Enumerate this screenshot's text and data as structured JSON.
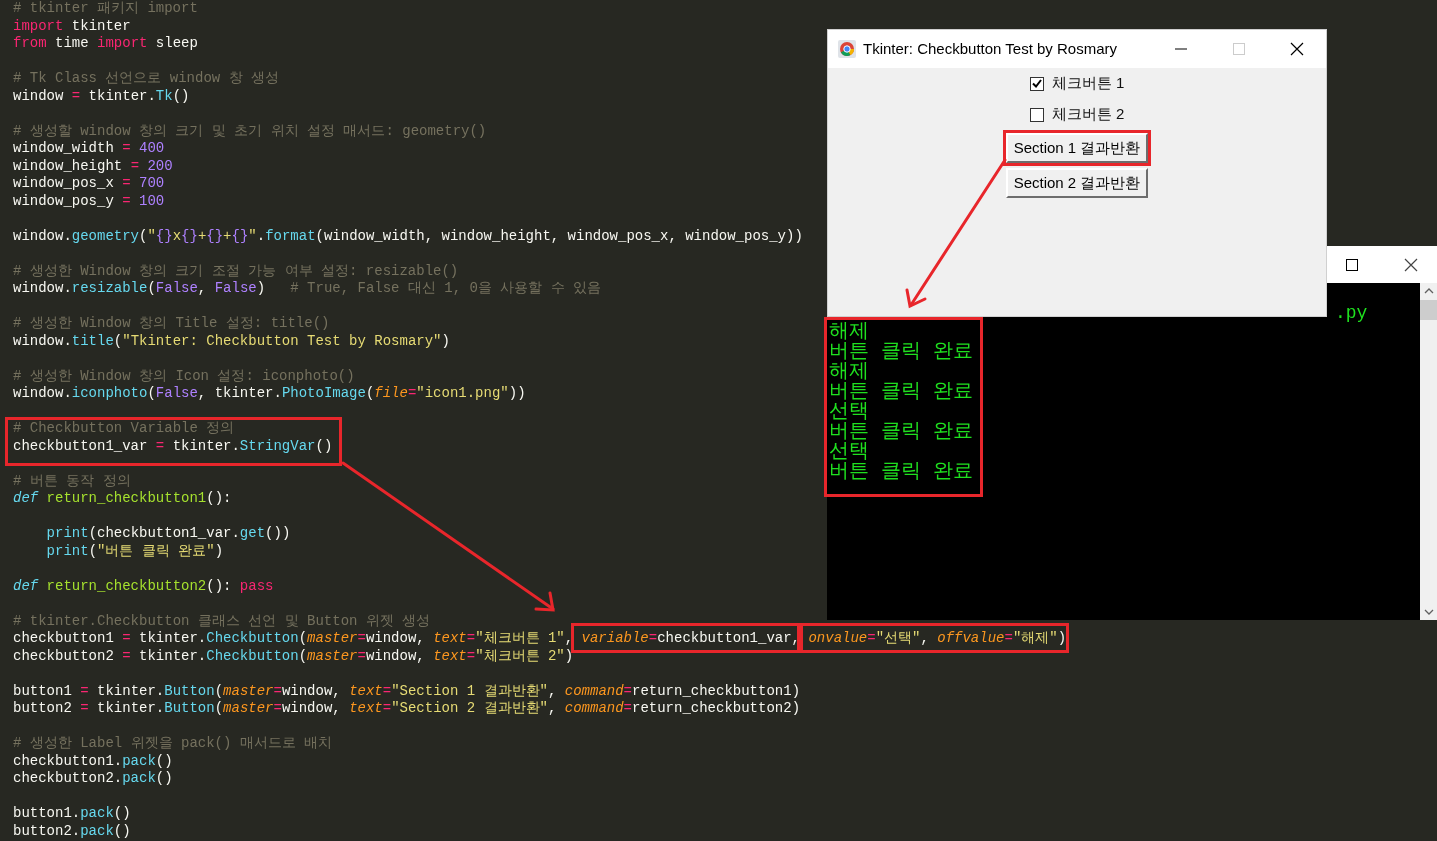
{
  "editor": {
    "lines": [
      {
        "kind": "code",
        "tokens": [
          {
            "text": "# tkinter 패키지 import",
            "kind": "comment"
          }
        ]
      },
      {
        "kind": "code",
        "tokens": [
          {
            "text": "import",
            "kind": "keyword"
          },
          {
            "text": " tkinter",
            "kind": "plain"
          }
        ]
      },
      {
        "kind": "code",
        "tokens": [
          {
            "text": "from",
            "kind": "keyword"
          },
          {
            "text": " time ",
            "kind": "plain"
          },
          {
            "text": "import",
            "kind": "keyword"
          },
          {
            "text": " sleep",
            "kind": "plain"
          }
        ]
      },
      {
        "kind": "blank"
      },
      {
        "kind": "code",
        "tokens": [
          {
            "text": "# Tk Class 선언으로 window 창 생성",
            "kind": "comment"
          }
        ]
      },
      {
        "kind": "code",
        "tokens": [
          {
            "text": "window ",
            "kind": "plain"
          },
          {
            "text": "=",
            "kind": "keyword"
          },
          {
            "text": " tkinter.",
            "kind": "plain"
          },
          {
            "text": "Tk",
            "kind": "call"
          },
          {
            "text": "()",
            "kind": "plain"
          }
        ]
      },
      {
        "kind": "blank"
      },
      {
        "kind": "code",
        "tokens": [
          {
            "text": "# 생성할 window 창의 크기 및 초기 위치 설정 매서드: geometry()",
            "kind": "comment"
          }
        ]
      },
      {
        "kind": "code",
        "tokens": [
          {
            "text": "window_width ",
            "kind": "plain"
          },
          {
            "text": "=",
            "kind": "keyword"
          },
          {
            "text": " 400",
            "kind": "number"
          }
        ]
      },
      {
        "kind": "code",
        "tokens": [
          {
            "text": "window_height ",
            "kind": "plain"
          },
          {
            "text": "=",
            "kind": "keyword"
          },
          {
            "text": " 200",
            "kind": "number"
          }
        ]
      },
      {
        "kind": "code",
        "tokens": [
          {
            "text": "window_pos_x ",
            "kind": "plain"
          },
          {
            "text": "=",
            "kind": "keyword"
          },
          {
            "text": " 700",
            "kind": "number"
          }
        ]
      },
      {
        "kind": "code",
        "tokens": [
          {
            "text": "window_pos_y ",
            "kind": "plain"
          },
          {
            "text": "=",
            "kind": "keyword"
          },
          {
            "text": " 100",
            "kind": "number"
          }
        ]
      },
      {
        "kind": "blank"
      },
      {
        "kind": "code",
        "tokens": [
          {
            "text": "window.",
            "kind": "plain"
          },
          {
            "text": "geometry",
            "kind": "call"
          },
          {
            "text": "(",
            "kind": "plain"
          },
          {
            "text": "\"",
            "kind": "string"
          },
          {
            "text": "{}",
            "kind": "number"
          },
          {
            "text": "x",
            "kind": "string"
          },
          {
            "text": "{}",
            "kind": "number"
          },
          {
            "text": "+",
            "kind": "string"
          },
          {
            "text": "{}",
            "kind": "number"
          },
          {
            "text": "+",
            "kind": "string"
          },
          {
            "text": "{}",
            "kind": "number"
          },
          {
            "text": "\"",
            "kind": "string"
          },
          {
            "text": ".",
            "kind": "plain"
          },
          {
            "text": "format",
            "kind": "call"
          },
          {
            "text": "(window_width, window_height, window_pos_x, window_pos_y))",
            "kind": "plain"
          }
        ]
      },
      {
        "kind": "blank"
      },
      {
        "kind": "code",
        "tokens": [
          {
            "text": "# 생성한 Window 창의 크기 조절 가능 여부 설정: resizable()",
            "kind": "comment"
          }
        ]
      },
      {
        "kind": "code",
        "tokens": [
          {
            "text": "window.",
            "kind": "plain"
          },
          {
            "text": "resizable",
            "kind": "call"
          },
          {
            "text": "(",
            "kind": "plain"
          },
          {
            "text": "False",
            "kind": "number"
          },
          {
            "text": ", ",
            "kind": "plain"
          },
          {
            "text": "False",
            "kind": "number"
          },
          {
            "text": ")   ",
            "kind": "plain"
          },
          {
            "text": "# True, False 대신 1, 0을 사용할 수 있음",
            "kind": "comment"
          }
        ]
      },
      {
        "kind": "blank"
      },
      {
        "kind": "code",
        "tokens": [
          {
            "text": "# 생성한 Window 창의 Title 설정: title()",
            "kind": "comment"
          }
        ]
      },
      {
        "kind": "code",
        "tokens": [
          {
            "text": "window.",
            "kind": "plain"
          },
          {
            "text": "title",
            "kind": "call"
          },
          {
            "text": "(",
            "kind": "plain"
          },
          {
            "text": "\"Tkinter: Checkbutton Test by Rosmary\"",
            "kind": "string"
          },
          {
            "text": ")",
            "kind": "plain"
          }
        ]
      },
      {
        "kind": "blank"
      },
      {
        "kind": "code",
        "tokens": [
          {
            "text": "# 생성한 Window 창의 Icon 설정: iconphoto()",
            "kind": "comment"
          }
        ]
      },
      {
        "kind": "code",
        "tokens": [
          {
            "text": "window.",
            "kind": "plain"
          },
          {
            "text": "iconphoto",
            "kind": "call"
          },
          {
            "text": "(",
            "kind": "plain"
          },
          {
            "text": "False",
            "kind": "number"
          },
          {
            "text": ", tkinter.",
            "kind": "plain"
          },
          {
            "text": "PhotoImage",
            "kind": "call"
          },
          {
            "text": "(",
            "kind": "plain"
          },
          {
            "text": "file",
            "kind": "param"
          },
          {
            "text": "=",
            "kind": "keyword"
          },
          {
            "text": "\"icon1.png\"",
            "kind": "string"
          },
          {
            "text": "))",
            "kind": "plain"
          }
        ]
      },
      {
        "kind": "blank"
      },
      {
        "kind": "highlight",
        "lines": [
          {
            "kind": "code",
            "tokens": [
              {
                "text": "# Checkbutton Variable 정의",
                "kind": "comment"
              }
            ]
          },
          {
            "kind": "code",
            "tokens": [
              {
                "text": "checkbutton1_var ",
                "kind": "plain"
              },
              {
                "text": "=",
                "kind": "keyword"
              },
              {
                "text": " tkinter.",
                "kind": "plain"
              },
              {
                "text": "StringVar",
                "kind": "call"
              },
              {
                "text": "()",
                "kind": "plain"
              }
            ]
          }
        ]
      },
      {
        "kind": "blank"
      },
      {
        "kind": "code",
        "tokens": [
          {
            "text": "# 버튼 동작 정의",
            "kind": "comment"
          }
        ]
      },
      {
        "kind": "code",
        "tokens": [
          {
            "text": "def ",
            "kind": "storage"
          },
          {
            "text": "return_checkbutton1",
            "kind": "function"
          },
          {
            "text": "():",
            "kind": "plain"
          }
        ]
      },
      {
        "kind": "blank"
      },
      {
        "kind": "code",
        "tokens": [
          {
            "text": "    print",
            "kind": "call"
          },
          {
            "text": "(checkbutton1_var.",
            "kind": "plain"
          },
          {
            "text": "get",
            "kind": "call"
          },
          {
            "text": "())",
            "kind": "plain"
          }
        ]
      },
      {
        "kind": "code",
        "tokens": [
          {
            "text": "    print",
            "kind": "call"
          },
          {
            "text": "(",
            "kind": "plain"
          },
          {
            "text": "\"버튼 클릭 완료\"",
            "kind": "string"
          },
          {
            "text": ")",
            "kind": "plain"
          }
        ]
      },
      {
        "kind": "blank"
      },
      {
        "kind": "code",
        "tokens": [
          {
            "text": "def ",
            "kind": "storage"
          },
          {
            "text": "return_checkbutton2",
            "kind": "function"
          },
          {
            "text": "(): ",
            "kind": "plain"
          },
          {
            "text": "pass",
            "kind": "keyword"
          }
        ]
      },
      {
        "kind": "blank"
      },
      {
        "kind": "code",
        "tokens": [
          {
            "text": "# tkinter.Checkbutton 클래스 선언 및 Button 위젯 생성",
            "kind": "comment"
          }
        ]
      },
      {
        "kind": "code",
        "tokens": [
          {
            "text": "checkbutton1 ",
            "kind": "plain"
          },
          {
            "text": "=",
            "kind": "keyword"
          },
          {
            "text": " tkinter.",
            "kind": "plain"
          },
          {
            "text": "Checkbutton",
            "kind": "call"
          },
          {
            "text": "(",
            "kind": "plain"
          },
          {
            "text": "master",
            "kind": "param"
          },
          {
            "text": "=",
            "kind": "keyword"
          },
          {
            "text": "window, ",
            "kind": "plain"
          },
          {
            "text": "text",
            "kind": "param"
          },
          {
            "text": "=",
            "kind": "keyword"
          },
          {
            "text": "\"체크버튼 1\"",
            "kind": "string"
          },
          {
            "text": ", ",
            "kind": "plain"
          },
          {
            "kind": "highlight",
            "tokens": [
              {
                "text": "variable",
                "kind": "param"
              },
              {
                "text": "=",
                "kind": "keyword"
              },
              {
                "text": "checkbutton1_var",
                "kind": "plain"
              }
            ]
          },
          {
            "text": ", ",
            "kind": "plain"
          },
          {
            "kind": "highlight",
            "tokens": [
              {
                "text": "onvalue",
                "kind": "param"
              },
              {
                "text": "=",
                "kind": "keyword"
              },
              {
                "text": "\"선택\"",
                "kind": "string"
              },
              {
                "text": ", ",
                "kind": "plain"
              },
              {
                "text": "offvalue",
                "kind": "param"
              },
              {
                "text": "=",
                "kind": "keyword"
              },
              {
                "text": "\"해제\"",
                "kind": "string"
              }
            ]
          },
          {
            "text": ")",
            "kind": "plain"
          }
        ]
      },
      {
        "kind": "code",
        "tokens": [
          {
            "text": "checkbutton2 ",
            "kind": "plain"
          },
          {
            "text": "=",
            "kind": "keyword"
          },
          {
            "text": " tkinter.",
            "kind": "plain"
          },
          {
            "text": "Checkbutton",
            "kind": "call"
          },
          {
            "text": "(",
            "kind": "plain"
          },
          {
            "text": "master",
            "kind": "param"
          },
          {
            "text": "=",
            "kind": "keyword"
          },
          {
            "text": "window, ",
            "kind": "plain"
          },
          {
            "text": "text",
            "kind": "param"
          },
          {
            "text": "=",
            "kind": "keyword"
          },
          {
            "text": "\"체크버튼 2\"",
            "kind": "string"
          },
          {
            "text": ")",
            "kind": "plain"
          }
        ]
      },
      {
        "kind": "blank"
      },
      {
        "kind": "code",
        "tokens": [
          {
            "text": "button1 ",
            "kind": "plain"
          },
          {
            "text": "=",
            "kind": "keyword"
          },
          {
            "text": " tkinter.",
            "kind": "plain"
          },
          {
            "text": "Button",
            "kind": "call"
          },
          {
            "text": "(",
            "kind": "plain"
          },
          {
            "text": "master",
            "kind": "param"
          },
          {
            "text": "=",
            "kind": "keyword"
          },
          {
            "text": "window, ",
            "kind": "plain"
          },
          {
            "text": "text",
            "kind": "param"
          },
          {
            "text": "=",
            "kind": "keyword"
          },
          {
            "text": "\"Section 1 결과반환\"",
            "kind": "string"
          },
          {
            "text": ", ",
            "kind": "plain"
          },
          {
            "text": "command",
            "kind": "param"
          },
          {
            "text": "=",
            "kind": "keyword"
          },
          {
            "text": "return_checkbutton1)",
            "kind": "plain"
          }
        ]
      },
      {
        "kind": "code",
        "tokens": [
          {
            "text": "button2 ",
            "kind": "plain"
          },
          {
            "text": "=",
            "kind": "keyword"
          },
          {
            "text": " tkinter.",
            "kind": "plain"
          },
          {
            "text": "Button",
            "kind": "call"
          },
          {
            "text": "(",
            "kind": "plain"
          },
          {
            "text": "master",
            "kind": "param"
          },
          {
            "text": "=",
            "kind": "keyword"
          },
          {
            "text": "window, ",
            "kind": "plain"
          },
          {
            "text": "text",
            "kind": "param"
          },
          {
            "text": "=",
            "kind": "keyword"
          },
          {
            "text": "\"Section 2 결과반환\"",
            "kind": "string"
          },
          {
            "text": ", ",
            "kind": "plain"
          },
          {
            "text": "command",
            "kind": "param"
          },
          {
            "text": "=",
            "kind": "keyword"
          },
          {
            "text": "return_checkbutton2)",
            "kind": "plain"
          }
        ]
      },
      {
        "kind": "blank"
      },
      {
        "kind": "code",
        "tokens": [
          {
            "text": "# 생성한 Label 위젯을 pack() 매서드로 배치",
            "kind": "comment"
          }
        ]
      },
      {
        "kind": "code",
        "tokens": [
          {
            "text": "checkbutton1.",
            "kind": "plain"
          },
          {
            "text": "pack",
            "kind": "call"
          },
          {
            "text": "()",
            "kind": "plain"
          }
        ]
      },
      {
        "kind": "code",
        "tokens": [
          {
            "text": "checkbutton2.",
            "kind": "plain"
          },
          {
            "text": "pack",
            "kind": "call"
          },
          {
            "text": "()",
            "kind": "plain"
          }
        ]
      },
      {
        "kind": "blank"
      },
      {
        "kind": "code",
        "tokens": [
          {
            "text": "button1.",
            "kind": "plain"
          },
          {
            "text": "pack",
            "kind": "call"
          },
          {
            "text": "()",
            "kind": "plain"
          }
        ]
      },
      {
        "kind": "code",
        "tokens": [
          {
            "text": "button2.",
            "kind": "plain"
          },
          {
            "text": "pack",
            "kind": "call"
          },
          {
            "text": "()",
            "kind": "plain"
          }
        ]
      }
    ]
  },
  "console": {
    "maximize_disabled": false,
    "script_path": ".py",
    "output": {
      "highlighted": true,
      "lines": [
        "해제",
        "버튼 클릭 완료",
        "해제",
        "버튼 클릭 완료",
        "선택",
        "버튼 클릭 완료",
        "선택",
        "버튼 클릭 완료"
      ]
    }
  },
  "app_window": {
    "title": "Tkinter: Checkbutton Test by Rosmary",
    "maximize_disabled": true,
    "checkbuttons": [
      {
        "label": "체크버튼 1",
        "checked": true
      },
      {
        "label": "체크버튼 2",
        "checked": false
      }
    ],
    "buttons": [
      {
        "label": "Section 1 결과반환",
        "highlighted": true
      },
      {
        "label": "Section 2 결과반환",
        "highlighted": false
      }
    ]
  }
}
